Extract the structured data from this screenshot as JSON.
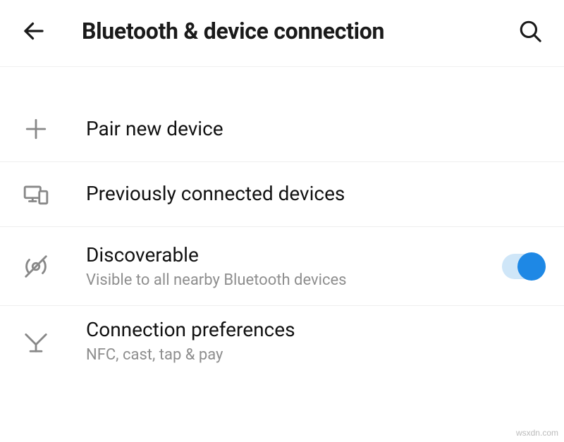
{
  "header": {
    "title": "Bluetooth & device connection"
  },
  "rows": {
    "pair": {
      "label": "Pair new device"
    },
    "previous": {
      "label": "Previously connected devices"
    },
    "discoverable": {
      "label": "Discoverable",
      "subtitle": "Visible to all nearby Bluetooth devices",
      "enabled": true
    },
    "preferences": {
      "label": "Connection preferences",
      "subtitle": "NFC, cast, tap & pay"
    }
  },
  "watermark": "wsxdn.com"
}
